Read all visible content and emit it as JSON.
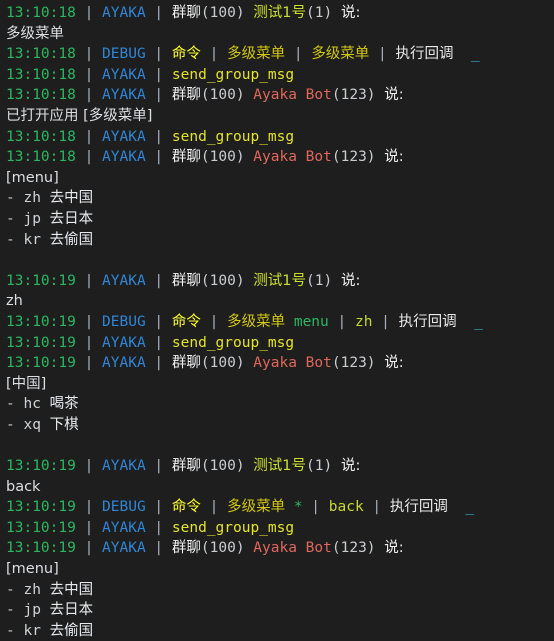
{
  "terminal": {
    "title": "console-log",
    "background_color": "#1e1e1e",
    "colors": {
      "timestamp": "#29b85f",
      "logger": "#2f86d6",
      "level_debug": "#2f86d6",
      "separator": "#a6b1bd",
      "command_label": "#ffff2d",
      "plugin_name": "#d2c80d",
      "subcommand": "#29b85f",
      "argument": "#c6d830",
      "api_name": "#e4e42a",
      "action_text": "#e9e9e9",
      "cursor": "#32c4e0",
      "group_label": "#f0f0f0",
      "entity_id": "#c9cdd1",
      "user_name": "#cbe02e",
      "bot_name": "#e0675c",
      "message_body": "#dcdfe3"
    },
    "glyphs": {
      "pipe": "|",
      "cursor": "_",
      "dash": "-",
      "star": "*",
      "colon": "说:"
    },
    "labels": {
      "logger": "AYAKA",
      "level_debug": "DEBUG",
      "command": "命令",
      "plugin": "多级菜单",
      "callback": "执行回调",
      "api": "send_group_msg",
      "group": "群聊",
      "say": "说:",
      "group_id": "(100)",
      "user": "测试1号",
      "user_id": "(1)",
      "bot": "Ayaka Bot",
      "bot_id": "(123)"
    },
    "lines": [
      {
        "id": "l01",
        "type": "message-header",
        "time": "13:10:18",
        "logger": "AYAKA",
        "group": "群聊",
        "group_id": "(100)",
        "speaker": "测试1号",
        "speaker_id": "(1)",
        "say": "说:"
      },
      {
        "id": "l02",
        "type": "body",
        "text": "多级菜单"
      },
      {
        "id": "l03",
        "type": "debug-callback",
        "time": "13:10:18",
        "level": "DEBUG",
        "command": "命令",
        "plugin": "多级菜单",
        "sub": "多级菜单",
        "sub_color": "plugin",
        "arg": "",
        "callback": "执行回调",
        "cursor": "_"
      },
      {
        "id": "l04",
        "type": "api-call",
        "time": "13:10:18",
        "logger": "AYAKA",
        "api": "send_group_msg"
      },
      {
        "id": "l05",
        "type": "bot-header",
        "time": "13:10:18",
        "logger": "AYAKA",
        "group": "群聊",
        "group_id": "(100)",
        "speaker": "Ayaka Bot",
        "speaker_id": "(123)",
        "say": "说:"
      },
      {
        "id": "l06",
        "type": "body",
        "text": "已打开应用 [多级菜单]"
      },
      {
        "id": "l07",
        "type": "api-call",
        "time": "13:10:18",
        "logger": "AYAKA",
        "api": "send_group_msg"
      },
      {
        "id": "l08",
        "type": "bot-header",
        "time": "13:10:18",
        "logger": "AYAKA",
        "group": "群聊",
        "group_id": "(100)",
        "speaker": "Ayaka Bot",
        "speaker_id": "(123)",
        "say": "说:"
      },
      {
        "id": "l09",
        "type": "body",
        "text": "[menu]"
      },
      {
        "id": "l10",
        "type": "menu-item",
        "dash": "-",
        "key": "zh",
        "desc": "去中国"
      },
      {
        "id": "l11",
        "type": "menu-item",
        "dash": "-",
        "key": "jp",
        "desc": "去日本"
      },
      {
        "id": "l12",
        "type": "menu-item",
        "dash": "-",
        "key": "kr",
        "desc": "去偷国"
      },
      {
        "id": "l13",
        "type": "blank",
        "text": ""
      },
      {
        "id": "l14",
        "type": "message-header",
        "time": "13:10:19",
        "logger": "AYAKA",
        "group": "群聊",
        "group_id": "(100)",
        "speaker": "测试1号",
        "speaker_id": "(1)",
        "say": "说:"
      },
      {
        "id": "l15",
        "type": "body",
        "text": "zh"
      },
      {
        "id": "l16",
        "type": "debug-callback",
        "time": "13:10:19",
        "level": "DEBUG",
        "command": "命令",
        "plugin": "多级菜单",
        "sub": "menu",
        "sub_color": "sub",
        "arg": "zh",
        "callback": "执行回调",
        "cursor": "_"
      },
      {
        "id": "l17",
        "type": "api-call",
        "time": "13:10:19",
        "logger": "AYAKA",
        "api": "send_group_msg"
      },
      {
        "id": "l18",
        "type": "bot-header",
        "time": "13:10:19",
        "logger": "AYAKA",
        "group": "群聊",
        "group_id": "(100)",
        "speaker": "Ayaka Bot",
        "speaker_id": "(123)",
        "say": "说:"
      },
      {
        "id": "l19",
        "type": "body",
        "text": "[中国]"
      },
      {
        "id": "l20",
        "type": "menu-item",
        "dash": "-",
        "key": "hc",
        "desc": "喝茶"
      },
      {
        "id": "l21",
        "type": "menu-item",
        "dash": "-",
        "key": "xq",
        "desc": "下棋"
      },
      {
        "id": "l22",
        "type": "blank",
        "text": ""
      },
      {
        "id": "l23",
        "type": "message-header",
        "time": "13:10:19",
        "logger": "AYAKA",
        "group": "群聊",
        "group_id": "(100)",
        "speaker": "测试1号",
        "speaker_id": "(1)",
        "say": "说:"
      },
      {
        "id": "l24",
        "type": "body",
        "text": "back"
      },
      {
        "id": "l25",
        "type": "debug-callback",
        "time": "13:10:19",
        "level": "DEBUG",
        "command": "命令",
        "plugin": "多级菜单",
        "sub": "*",
        "sub_color": "sub",
        "arg": "back",
        "callback": "执行回调",
        "cursor": "_"
      },
      {
        "id": "l26",
        "type": "api-call",
        "time": "13:10:19",
        "logger": "AYAKA",
        "api": "send_group_msg"
      },
      {
        "id": "l27",
        "type": "bot-header",
        "time": "13:10:19",
        "logger": "AYAKA",
        "group": "群聊",
        "group_id": "(100)",
        "speaker": "Ayaka Bot",
        "speaker_id": "(123)",
        "say": "说:"
      },
      {
        "id": "l28",
        "type": "body",
        "text": "[menu]"
      },
      {
        "id": "l29",
        "type": "menu-item",
        "dash": "-",
        "key": "zh",
        "desc": "去中国"
      },
      {
        "id": "l30",
        "type": "menu-item",
        "dash": "-",
        "key": "jp",
        "desc": "去日本"
      },
      {
        "id": "l31",
        "type": "menu-item",
        "dash": "-",
        "key": "kr",
        "desc": "去偷国"
      }
    ]
  }
}
